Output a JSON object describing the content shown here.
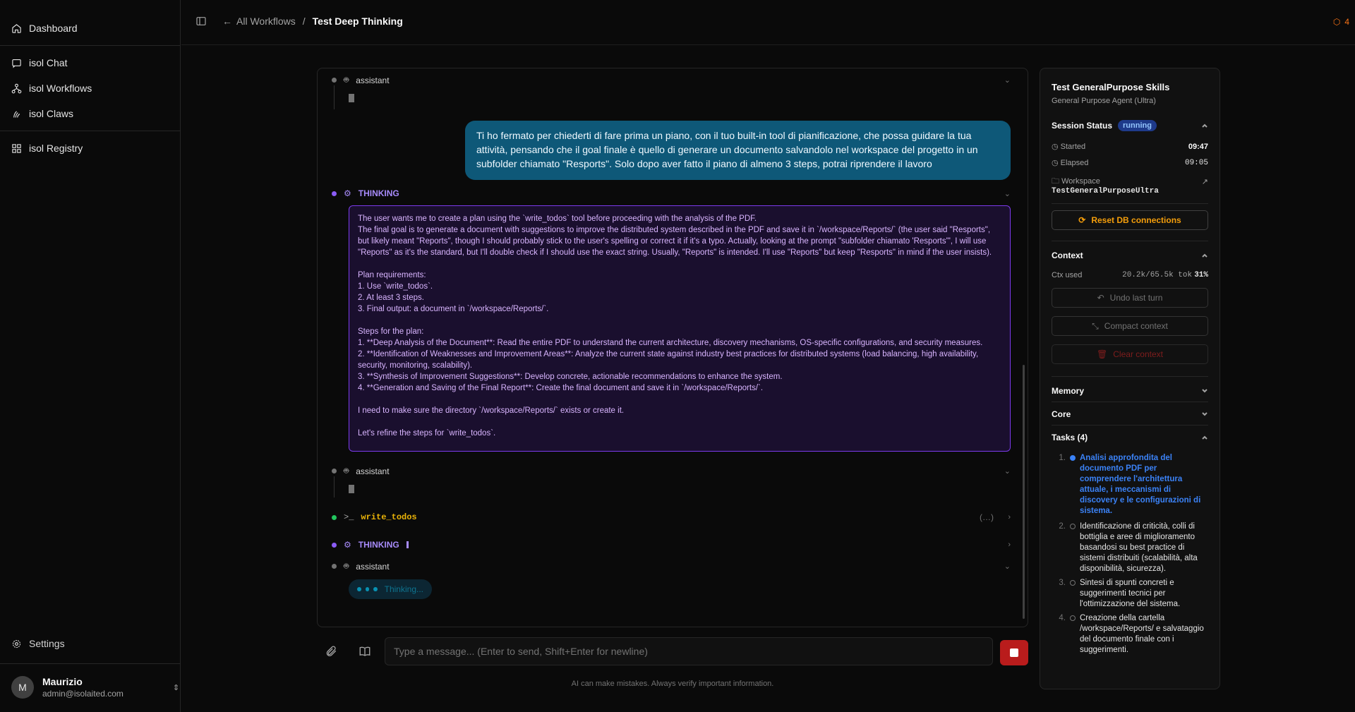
{
  "sidebar": {
    "items": [
      {
        "label": "Dashboard",
        "icon": "home-icon"
      },
      {
        "label": "isol Chat",
        "icon": "chat-icon"
      },
      {
        "label": "isol Workflows",
        "icon": "workflow-icon"
      },
      {
        "label": "isol Claws",
        "icon": "claws-icon"
      },
      {
        "label": "isol Registry",
        "icon": "grid-icon"
      }
    ],
    "settings_label": "Settings",
    "user": {
      "initial": "M",
      "name": "Maurizio",
      "email": "admin@isolaited.com"
    }
  },
  "header": {
    "back_label": "All Workflows",
    "separator": "/",
    "current": "Test Deep Thinking",
    "badge_count": "4"
  },
  "chat": {
    "messages": {
      "assistant_label": "assistant",
      "user_message": "Ti ho fermato per chiederti di fare prima un piano, con il tuo built-in tool di pianificazione, che possa guidare la tua attività, pensando che il goal finale è quello di generare un documento salvandolo nel workspace del progetto in un subfolder chiamato \"Resports\". Solo dopo aver fatto il piano di almeno 3 steps, potrai riprendere il lavoro",
      "thinking_label": "THINKING",
      "thinking_text": "The user wants me to create a plan using the `write_todos` tool before proceeding with the analysis of the PDF.\nThe final goal is to generate a document with suggestions to improve the distributed system described in the PDF and save it in `/workspace/Reports/` (the user said \"Resports\", but likely meant \"Reports\", though I should probably stick to the user's spelling or correct it if it's a typo. Actually, looking at the prompt \"subfolder chiamato 'Resports'\", I will use \"Reports\" as it's the standard, but I'll double check if I should use the exact string. Usually, \"Reports\" is intended. I'll use \"Reports\" but keep \"Resports\" in mind if the user insists).\n\nPlan requirements:\n1. Use `write_todos`.\n2. At least 3 steps.\n3. Final output: a document in `/workspace/Reports/`.\n\nSteps for the plan:\n1. **Deep Analysis of the Document**: Read the entire PDF to understand the current architecture, discovery mechanisms, OS-specific configurations, and security measures.\n2. **Identification of Weaknesses and Improvement Areas**: Analyze the current state against industry best practices for distributed systems (load balancing, high availability, security, monitoring, scalability).\n3. **Synthesis of Improvement Suggestions**: Develop concrete, actionable recommendations to enhance the system.\n4. **Generation and Saving of the Final Report**: Create the final document and save it in `/workspace/Reports/`.\n\nI need to make sure the directory `/workspace/Reports/` exists or create it.\n\nLet's refine the steps for `write_todos`.",
      "tool_name": "write_todos",
      "tool_args": "(…)",
      "thinking_label_2": "THINKING",
      "thinking_status": "Thinking..."
    },
    "input_placeholder": "Type a message... (Enter to send, Shift+Enter for newline)",
    "footer_note": "AI can make mistakes. Always verify important information."
  },
  "panel": {
    "title": "Test GeneralPurpose Skills",
    "subtitle": "General Purpose Agent (Ultra)",
    "session_status_label": "Session Status",
    "status": "running",
    "started_label": "Started",
    "started_value": "09:47",
    "elapsed_label": "Elapsed",
    "elapsed_value": "09:05",
    "workspace_label": "Workspace",
    "workspace_value": "TestGeneralPurposeUltra",
    "reset_label": "Reset DB connections",
    "context_label": "Context",
    "ctx_used_label": "Ctx used",
    "ctx_used_value": "20.2k/65.5k tok",
    "ctx_percent": "31%",
    "undo_label": "Undo last turn",
    "compact_label": "Compact context",
    "clear_label": "Clear context",
    "memory_label": "Memory",
    "core_label": "Core",
    "tasks_label": "Tasks (4)",
    "tasks": [
      {
        "num": "1.",
        "text": "Analisi approfondita del documento PDF per comprendere l'architettura attuale, i meccanismi di discovery e le configurazioni di sistema.",
        "active": true
      },
      {
        "num": "2.",
        "text": "Identificazione di criticità, colli di bottiglia e aree di miglioramento basandosi su best practice di sistemi distribuiti (scalabilità, alta disponibilità, sicurezza).",
        "active": false
      },
      {
        "num": "3.",
        "text": "Sintesi di spunti concreti e suggerimenti tecnici per l'ottimizzazione del sistema.",
        "active": false
      },
      {
        "num": "4.",
        "text": "Creazione della cartella /workspace/Reports/ e salvataggio del documento finale con i suggerimenti.",
        "active": false
      }
    ]
  },
  "colors": {
    "accent": "#0e5878",
    "thinking": "#7c3aed",
    "tool": "#eab308",
    "danger": "#b91c1c",
    "task_active": "#3b82f6"
  }
}
